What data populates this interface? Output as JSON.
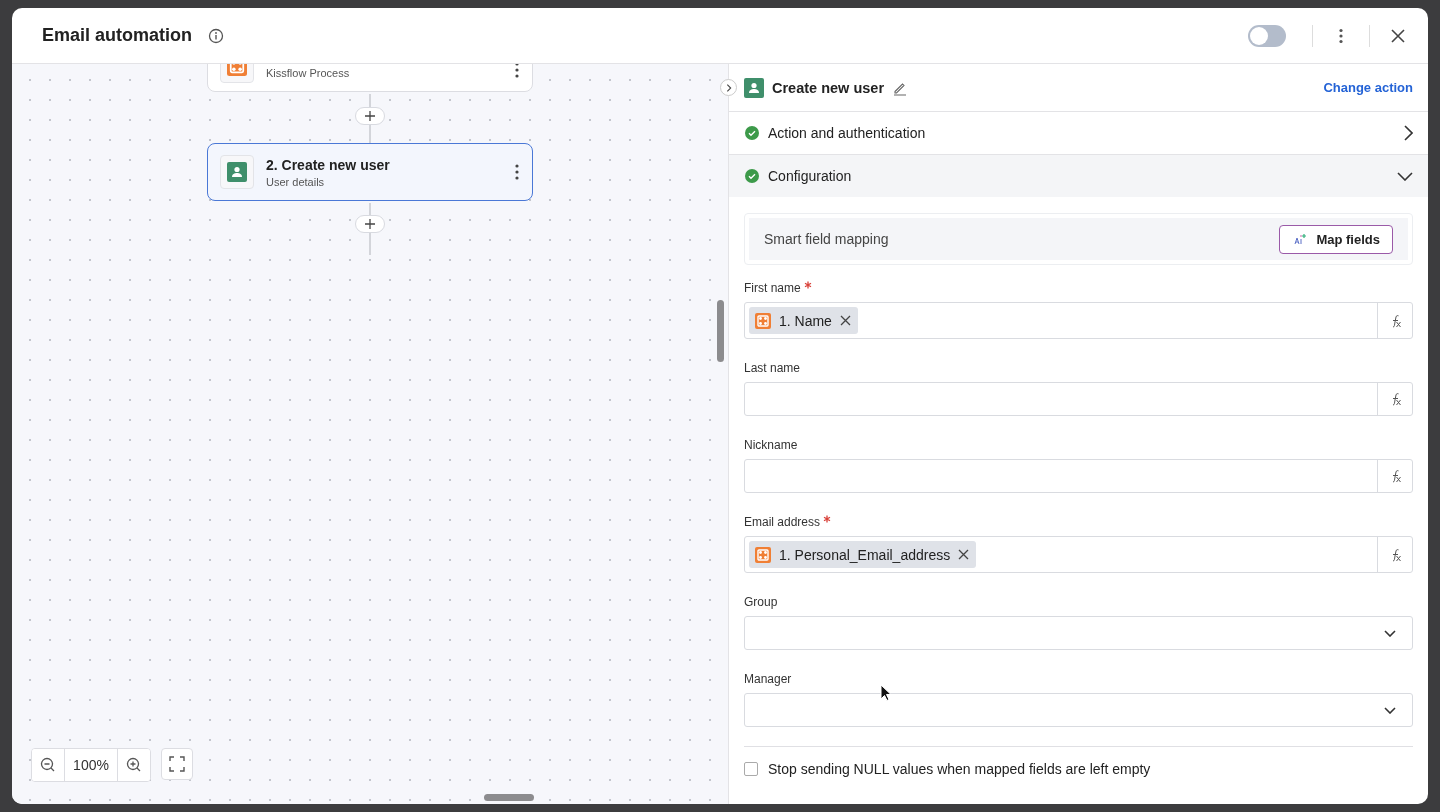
{
  "window": {
    "title": "Email automation",
    "enabled": false
  },
  "canvas": {
    "nodes": [
      {
        "kind": "trigger",
        "subtitle": "Kissflow Process",
        "selected": false
      },
      {
        "kind": "action",
        "title": "2. Create new user",
        "subtitle": "User details",
        "selected": true
      }
    ],
    "zoom": "100%"
  },
  "panel": {
    "title": "Create new user",
    "change_action": "Change action",
    "sections": [
      {
        "label": "Action and authentication",
        "done": true,
        "expanded": false
      },
      {
        "label": "Configuration",
        "done": true,
        "expanded": true
      }
    ],
    "smart_mapping": {
      "label": "Smart field mapping",
      "button": "Map fields"
    },
    "fields": [
      {
        "kind": "mapped",
        "label": "First name",
        "required": true,
        "tokens": [
          "1. Name"
        ]
      },
      {
        "kind": "mapped",
        "label": "Last name",
        "required": false
      },
      {
        "kind": "mapped",
        "label": "Nickname",
        "required": false
      },
      {
        "kind": "mapped",
        "label": "Email address",
        "required": true,
        "tokens": [
          "1. Personal_Email_address"
        ]
      },
      {
        "kind": "dropdown",
        "label": "Group",
        "required": false
      },
      {
        "kind": "dropdown",
        "label": "Manager",
        "required": false
      }
    ],
    "null_option": {
      "label": "Stop sending NULL values when mapped fields are left empty",
      "checked": false
    }
  }
}
